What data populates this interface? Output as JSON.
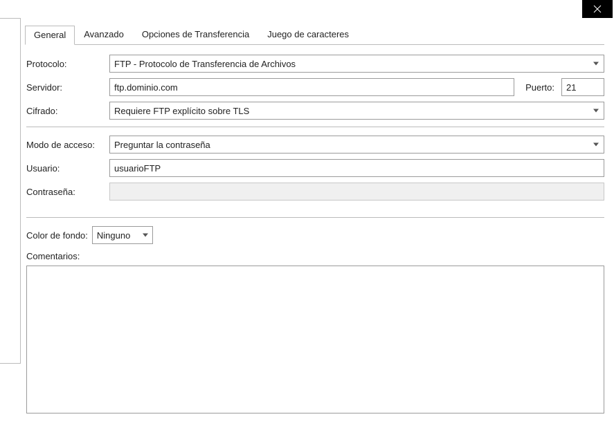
{
  "tabs": {
    "general": "General",
    "advanced": "Avanzado",
    "transfer": "Opciones de Transferencia",
    "charset": "Juego de caracteres"
  },
  "form": {
    "protocol_label": "Protocolo:",
    "protocol_value": "FTP - Protocolo de Transferencia de Archivos",
    "host_label": "Servidor:",
    "host_value": "ftp.dominio.com",
    "port_label": "Puerto:",
    "port_value": "21",
    "encryption_label": "Cifrado:",
    "encryption_value": "Requiere FTP explícito sobre TLS",
    "logontype_label": "Modo de acceso:",
    "logontype_value": "Preguntar la contraseña",
    "user_label": "Usuario:",
    "user_value": "usuarioFTP",
    "password_label": "Contraseña:",
    "password_value": "",
    "bgcolor_label": "Color de fondo:",
    "bgcolor_value": "Ninguno",
    "comments_label": "Comentarios:",
    "comments_value": ""
  }
}
